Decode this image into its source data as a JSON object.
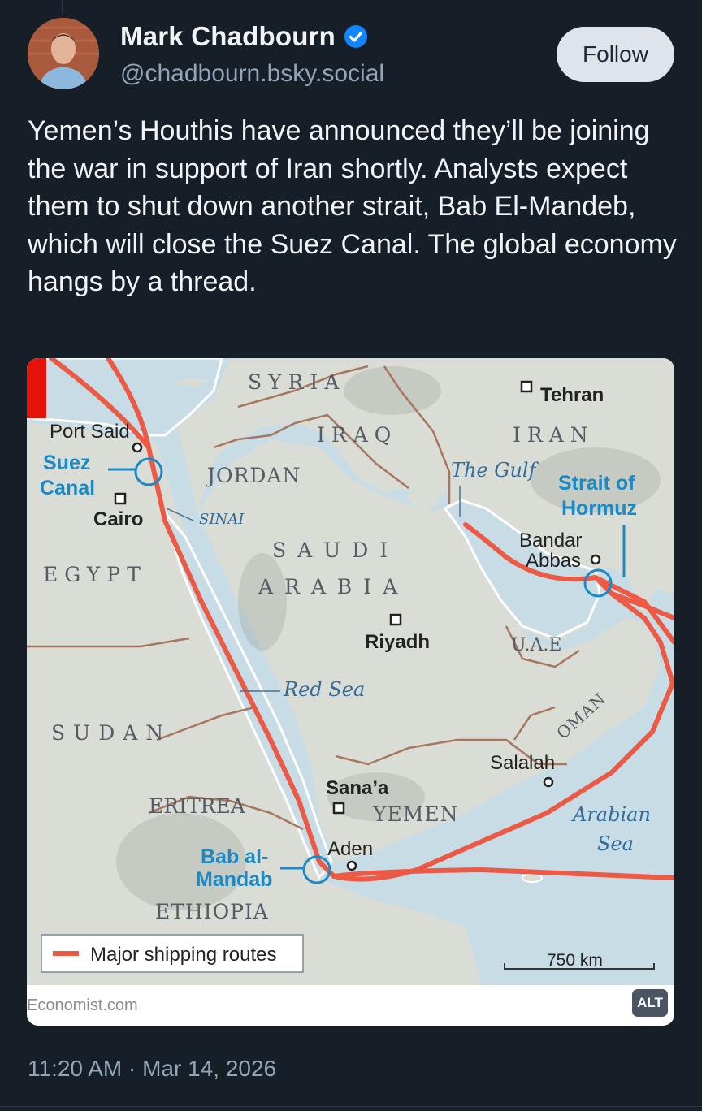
{
  "author": {
    "display_name": "Mark Chadbourn",
    "handle": "@chadbourn.bsky.social",
    "verified": true,
    "avatar_icon": "avatar-photo"
  },
  "follow_label": "Follow",
  "post": {
    "text": "Yemen’s Houthis have announced they’ll be joining the war in support of Iran shortly. Analysts expect them to shut down another strait, Bab El-Mandeb, which will close the Suez Canal. The global economy hangs by a thread.",
    "timestamp": "11:20 AM · Mar 14, 2026"
  },
  "embed": {
    "source": "Economist.com",
    "alt_badge": "ALT",
    "map": {
      "countries": {
        "syria": "SYRIA",
        "iraq": "IRAQ",
        "iran": "IRAN",
        "jordan": "JORDAN",
        "egypt": "EGYPT",
        "saudi_1": "SAUDI",
        "saudi_2": "ARABIA",
        "sudan": "SUDAN",
        "eritrea": "ERITREA",
        "ethiopia": "ETHIOPIA",
        "yemen": "YEMEN",
        "oman": "OMAN",
        "uae": "U.A.E"
      },
      "cities": {
        "tehran": "Tehran",
        "port_said": "Port Said",
        "cairo": "Cairo",
        "riyadh": "Riyadh",
        "bandar_1": "Bandar",
        "bandar_2": "Abbas",
        "salalah": "Salalah",
        "sanaa": "Sana’a",
        "aden": "Aden"
      },
      "regions": {
        "sinai": "SINAI",
        "the_gulf": "The Gulf",
        "red_sea": "Red Sea",
        "arabian_1": "Arabian",
        "arabian_2": "Sea"
      },
      "chokepoints": {
        "suez_1": "Suez",
        "suez_2": "Canal",
        "hormuz_1": "Strait of",
        "hormuz_2": "Hormuz",
        "bab_1": "Bab al-",
        "bab_2": "Mandab"
      },
      "legend_label": "Major shipping routes",
      "scale_label": "750 km",
      "colors": {
        "sea": "#c8dce6",
        "land": "#d9ddd6",
        "route": "#ec5a45",
        "border": "#a8765f",
        "accent": "#1a8ac7"
      }
    }
  },
  "colors": {
    "background": "#161e27",
    "text": "#f1f3f5",
    "muted": "#93a5b7",
    "button_bg": "#dfe4ea",
    "verified": "#1185fe"
  }
}
